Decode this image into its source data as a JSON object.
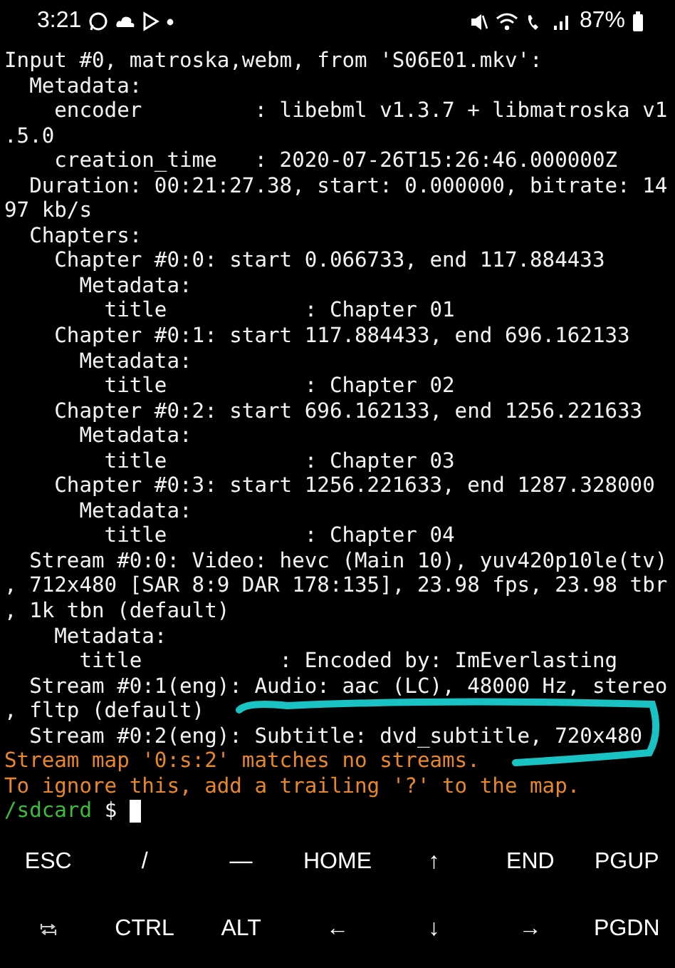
{
  "status_bar": {
    "time": "3:21",
    "battery": "87%"
  },
  "terminal": {
    "lines": [
      {
        "kind": "output",
        "text": "Input #0, matroska,webm, from 'S06E01.mkv':"
      },
      {
        "kind": "output",
        "text": "  Metadata:"
      },
      {
        "kind": "output",
        "text": "    encoder         : libebml v1.3.7 + libmatroska v1"
      },
      {
        "kind": "output",
        "text": ".5.0"
      },
      {
        "kind": "output",
        "text": "    creation_time   : 2020-07-26T15:26:46.000000Z"
      },
      {
        "kind": "output",
        "text": "  Duration: 00:21:27.38, start: 0.000000, bitrate: 14"
      },
      {
        "kind": "output",
        "text": "97 kb/s"
      },
      {
        "kind": "output",
        "text": "  Chapters:"
      },
      {
        "kind": "output",
        "text": "    Chapter #0:0: start 0.066733, end 117.884433"
      },
      {
        "kind": "output",
        "text": "      Metadata:"
      },
      {
        "kind": "output",
        "text": "        title           : Chapter 01"
      },
      {
        "kind": "output",
        "text": "    Chapter #0:1: start 117.884433, end 696.162133"
      },
      {
        "kind": "output",
        "text": "      Metadata:"
      },
      {
        "kind": "output",
        "text": "        title           : Chapter 02"
      },
      {
        "kind": "output",
        "text": "    Chapter #0:2: start 696.162133, end 1256.221633"
      },
      {
        "kind": "output",
        "text": "      Metadata:"
      },
      {
        "kind": "output",
        "text": "        title           : Chapter 03"
      },
      {
        "kind": "output",
        "text": "    Chapter #0:3: start 1256.221633, end 1287.328000"
      },
      {
        "kind": "output",
        "text": "      Metadata:"
      },
      {
        "kind": "output",
        "text": "        title           : Chapter 04"
      },
      {
        "kind": "output",
        "text": "  Stream #0:0: Video: hevc (Main 10), yuv420p10le(tv)"
      },
      {
        "kind": "output",
        "text": ", 712x480 [SAR 8:9 DAR 178:135], 23.98 fps, 23.98 tbr"
      },
      {
        "kind": "output",
        "text": ", 1k tbn (default)"
      },
      {
        "kind": "output",
        "text": "    Metadata:"
      },
      {
        "kind": "output",
        "text": "      title           : Encoded by: ImEverlasting"
      },
      {
        "kind": "output",
        "text": "  Stream #0:1(eng): Audio: aac (LC), 48000 Hz, stereo"
      },
      {
        "kind": "output",
        "text": ", fltp (default)"
      },
      {
        "kind": "output",
        "text": "  Stream #0:2(eng): Subtitle: dvd_subtitle, 720x480"
      },
      {
        "kind": "error",
        "text": "Stream map '0:s:2' matches no streams."
      },
      {
        "kind": "error",
        "text": "To ignore this, add a trailing '?' to the map."
      }
    ],
    "prompt": {
      "path": "/sdcard",
      "symbol": "$"
    }
  },
  "extra_keys": [
    [
      {
        "kind": "text",
        "label": "ESC"
      },
      {
        "kind": "text",
        "label": "/"
      },
      {
        "kind": "text",
        "label": "—"
      },
      {
        "kind": "text",
        "label": "HOME"
      },
      {
        "kind": "text",
        "label": "↑"
      },
      {
        "kind": "text",
        "label": "END"
      },
      {
        "kind": "text",
        "label": "PGUP"
      }
    ],
    [
      {
        "kind": "tab"
      },
      {
        "kind": "text",
        "label": "CTRL"
      },
      {
        "kind": "text",
        "label": "ALT"
      },
      {
        "kind": "text",
        "label": "←"
      },
      {
        "kind": "text",
        "label": "↓"
      },
      {
        "kind": "text",
        "label": "→"
      },
      {
        "kind": "text",
        "label": "PGDN"
      }
    ]
  ]
}
